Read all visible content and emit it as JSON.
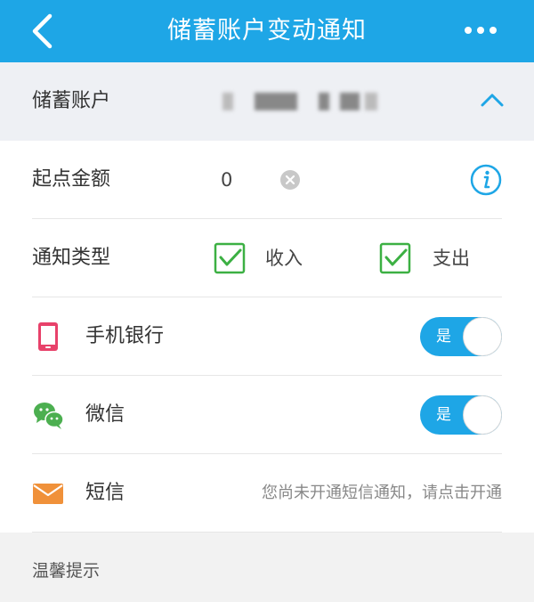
{
  "header": {
    "title": "储蓄账户变动通知",
    "back_icon": "chevron-left-icon",
    "more_icon": "more-dots-icon",
    "bg_color": "#1ea6e6"
  },
  "account": {
    "label": "储蓄账户",
    "expand_icon": "chevron-up-icon"
  },
  "threshold": {
    "label": "起点金额",
    "value": "0",
    "clear_icon": "clear-icon",
    "info_icon": "info-icon"
  },
  "notify_type": {
    "label": "通知类型",
    "options": [
      {
        "label": "收入",
        "checked": true
      },
      {
        "label": "支出",
        "checked": true
      }
    ]
  },
  "channels": [
    {
      "label": "手机银行",
      "icon": "phone-icon",
      "toggle_label": "是",
      "enabled": true
    },
    {
      "label": "微信",
      "icon": "wechat-icon",
      "toggle_label": "是",
      "enabled": true
    },
    {
      "label": "短信",
      "icon": "envelope-icon",
      "hint": "您尚未开通短信通知，请点击开通"
    }
  ],
  "tips": {
    "title": "温馨提示"
  },
  "colors": {
    "accent": "#1ea6e6",
    "check_green": "#3cb043",
    "phone_pink": "#e8416a",
    "wechat_green": "#4caf50",
    "sms_orange": "#f0913a"
  }
}
